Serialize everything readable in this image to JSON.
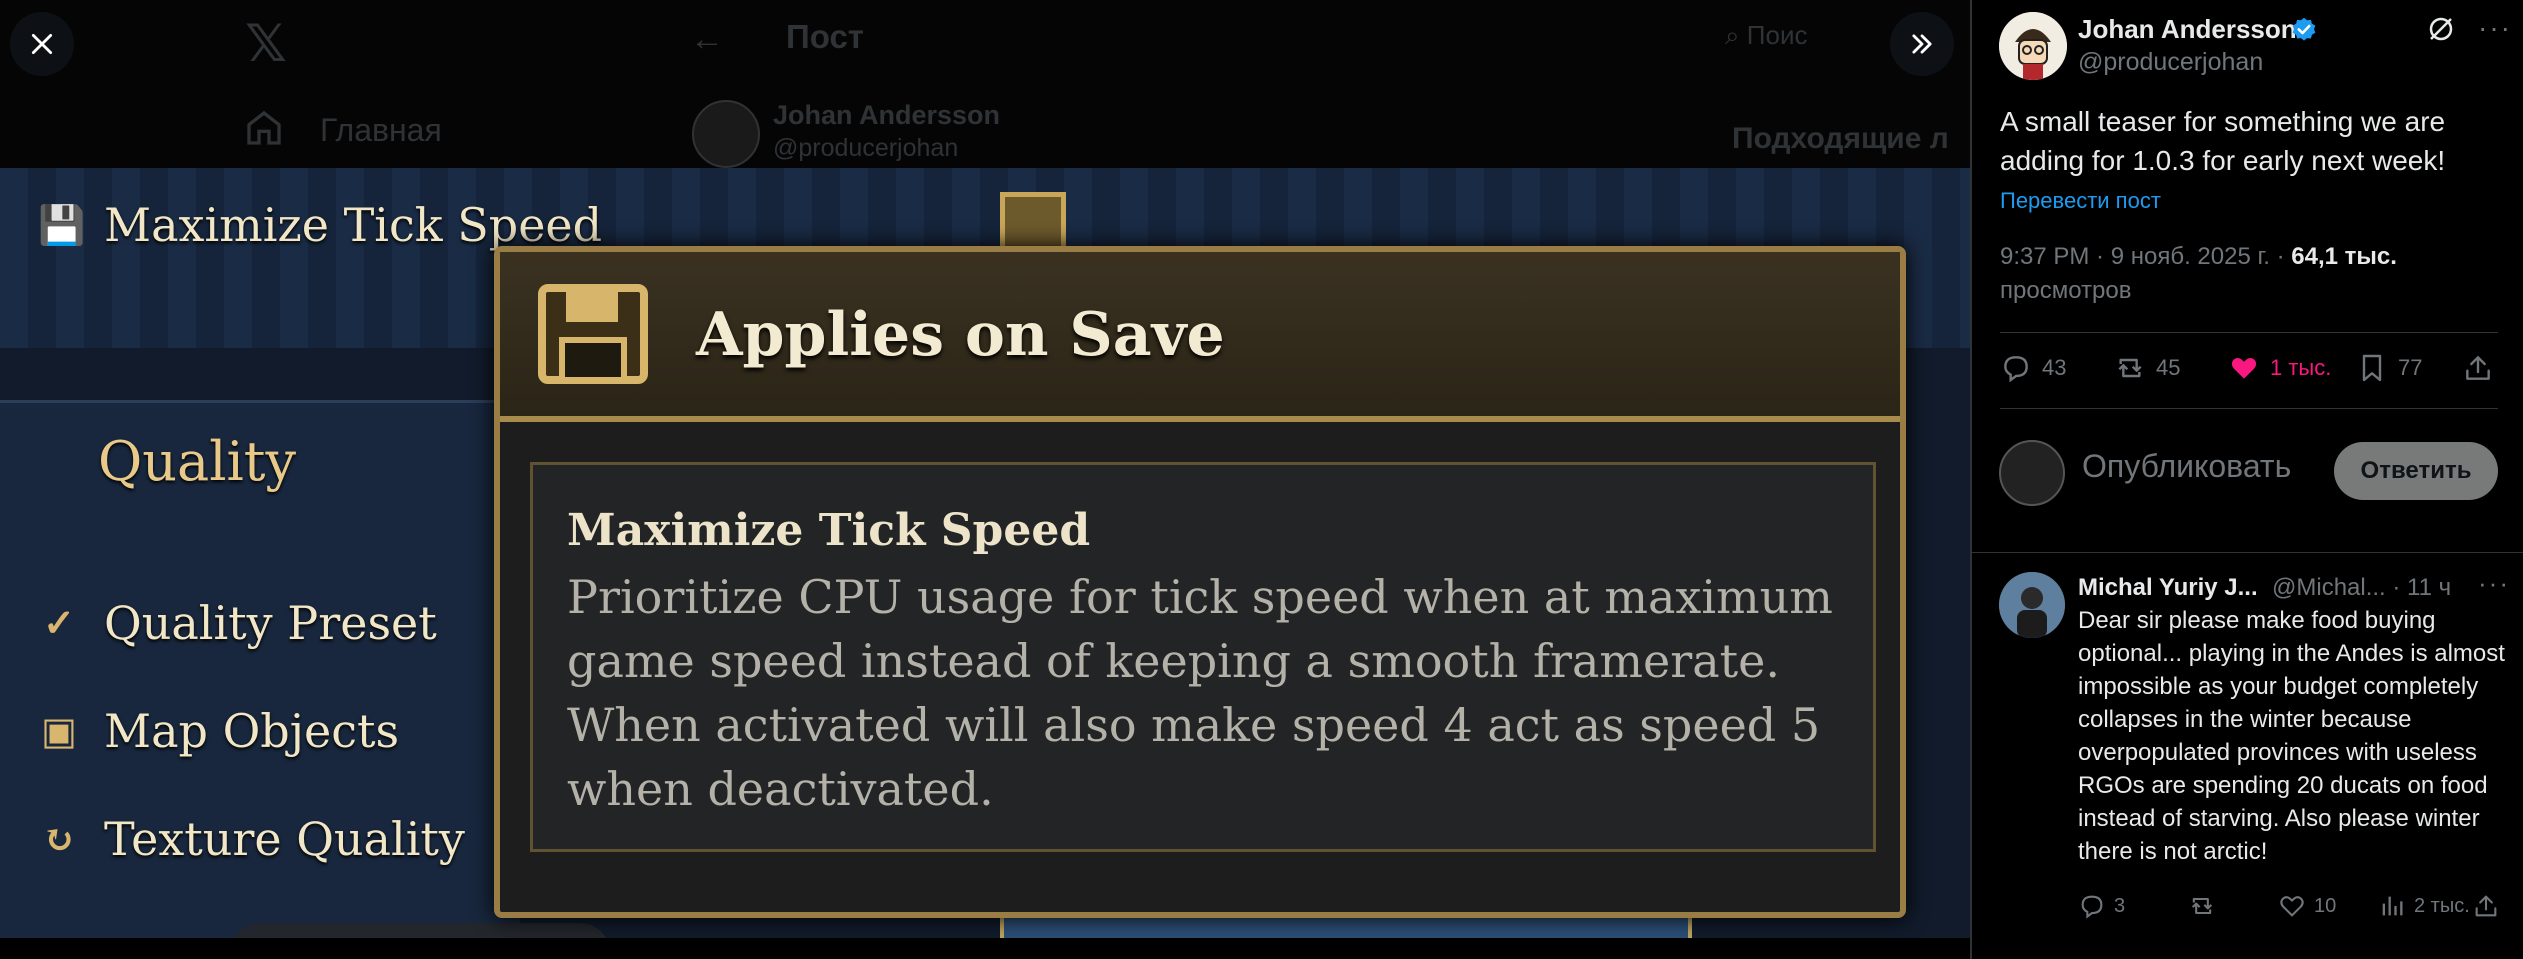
{
  "background": {
    "post_header": "Пост",
    "nav_home": "Главная",
    "search_text": "Поис",
    "author_name": "Johan Andersson",
    "author_handle": "@producerjohan",
    "related_heading": "Подходящие л"
  },
  "game": {
    "top_row_label": "Maximize Tick Speed",
    "section_heading": "Quality",
    "rows": [
      {
        "label": "Quality Preset",
        "icon": "check-circle-icon"
      },
      {
        "label": "Map Objects",
        "icon": "floppy-icon"
      },
      {
        "label": "Texture Quality",
        "icon": "refresh-icon"
      }
    ],
    "tooltip": {
      "title": "Applies on Save",
      "subtitle": "Maximize Tick Speed",
      "description": "Prioritize CPU usage for tick speed when at maximum game speed instead of keeping a smooth framerate. When activated will also make speed 4 act as speed 5 when deactivated."
    }
  },
  "post": {
    "author_name": "Johan Andersson",
    "author_handle": "@producerjohan",
    "text": "A small teaser for something we are adding for 1.0.3 for early next week!",
    "translate_label": "Перевести пост",
    "timestamp": "9:37 PM · 9 нояб. 2025 г. · ",
    "views_count": "64,1 тыс.",
    "views_label": "просмотров",
    "actions": {
      "replies": "43",
      "reposts": "45",
      "likes": "1 тыс.",
      "bookmarks": "77"
    },
    "reply_placeholder": "Опубликовать",
    "reply_button": "Ответить"
  },
  "reply": {
    "author_name": "Michal Yuriy J...",
    "author_handle": "@Michal...",
    "time": "· 11 ч",
    "text": "Dear sir please make food buying optional... playing in the Andes is almost impossible as your budget completely collapses in the winter because overpopulated provinces with useless RGOs are spending 20 ducats on food instead of starving. Also please winter there is not arctic!",
    "actions": {
      "replies": "3",
      "likes": "10",
      "views": "2 тыс."
    }
  },
  "colors": {
    "like_pink": "#f91880",
    "link_blue": "#1d9bf0",
    "verified_blue": "#1d9bf0",
    "muted_gray": "#71767b",
    "gold": "#caa659"
  }
}
